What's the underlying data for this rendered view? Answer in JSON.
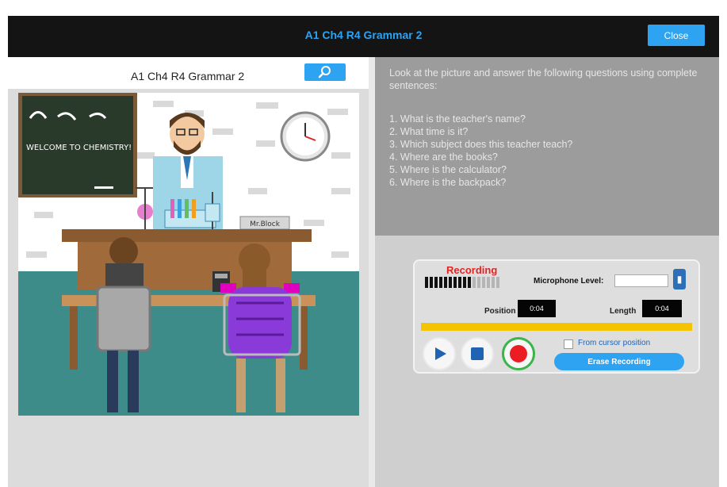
{
  "window": {
    "title": "A1 Ch4 R4 Grammar 2",
    "close_label": "Close"
  },
  "left_panel": {
    "title": "A1 Ch4 R4 Grammar 2",
    "zoom_icon": "magnifier-icon",
    "picture": {
      "board_text": "WELCOME TO CHEMISTRY!",
      "nameplate": "Mr.Block"
    }
  },
  "questions_panel": {
    "instructions": "Look at the picture and answer the following questions using complete sentences:",
    "questions": [
      "1. What is the teacher's name?",
      "2. What time is it?",
      "3. Which subject does this teacher teach?",
      "4. Where are the books?",
      "5. Where is the calculator?",
      "6. Where is the backpack?"
    ]
  },
  "recorder": {
    "status": "Recording",
    "vu_level": 0.6,
    "microphone_label": "Microphone Level:",
    "position_label": "Position",
    "position_value": "0:04",
    "length_label": "Length",
    "length_value": "0:04",
    "progress": 1.0,
    "from_cursor_label": "From cursor position",
    "from_cursor_checked": false,
    "erase_label": "Erase Recording",
    "colors": {
      "accent": "#2ea3f2",
      "progress": "#f4c400",
      "record": "#ec1c24",
      "record_ring": "#39b54a",
      "status_text": "#e32222"
    }
  }
}
